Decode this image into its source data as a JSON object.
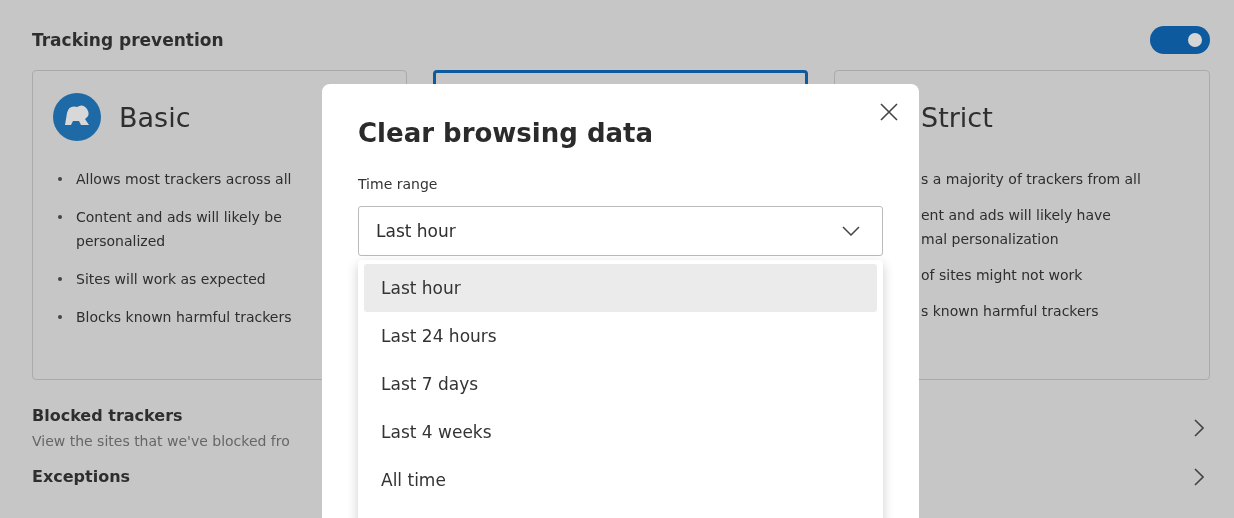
{
  "section": {
    "title": "Tracking prevention",
    "toggle": {
      "on": true
    }
  },
  "cards": [
    {
      "title": "Basic",
      "selected": false,
      "bullets": [
        "Allows most trackers across all",
        "Content and ads will likely be personalized",
        "Sites will work as expected",
        "Blocks known harmful trackers"
      ]
    },
    {
      "selected": true
    },
    {
      "title": "Strict",
      "selected": false,
      "bullets": [
        "s a majority of trackers from all",
        "ent and ads will likely have\nmal personalization",
        "of sites might not work",
        "s known harmful trackers"
      ]
    }
  ],
  "rows": [
    {
      "title": "Blocked trackers",
      "description": "View the sites that we've blocked fro"
    },
    {
      "title": "Exceptions"
    }
  ],
  "dialog": {
    "title": "Clear browsing data",
    "time_range": {
      "label": "Time range",
      "value": "Last hour",
      "options": [
        {
          "label": "Last hour",
          "selected": true
        },
        {
          "label": "Last 24 hours",
          "selected": false
        },
        {
          "label": "Last 7 days",
          "selected": false
        },
        {
          "label": "Last 4 weeks",
          "selected": false
        },
        {
          "label": "All time",
          "selected": false
        }
      ]
    }
  }
}
